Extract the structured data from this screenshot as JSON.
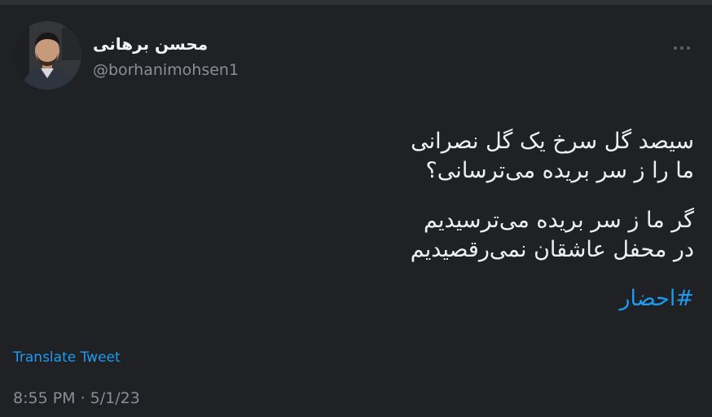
{
  "author": {
    "display_name": "محسن برهانی",
    "username": "@borhanimohsen1",
    "avatar_icon": "person-avatar"
  },
  "tweet": {
    "stanza1": {
      "line1": "سیصد گل سرخ یک گل نصرانی",
      "line2": "ما را ز سر بریده می‌ترسانی؟"
    },
    "stanza2": {
      "line1": "گر ما ز سر بریده می‌ترسیدیم",
      "line2": "در محفل عاشقان نمی‌رقصیدیم"
    },
    "hashtag": "#احضار"
  },
  "translate_label": "Translate Tweet",
  "timestamp": "8:55 PM · 5/1/23",
  "more_icon": "more-dots-icon",
  "colors": {
    "background": "#202124",
    "link": "#1d9bf0",
    "muted": "#8b8f94",
    "text": "#eef0f2"
  }
}
